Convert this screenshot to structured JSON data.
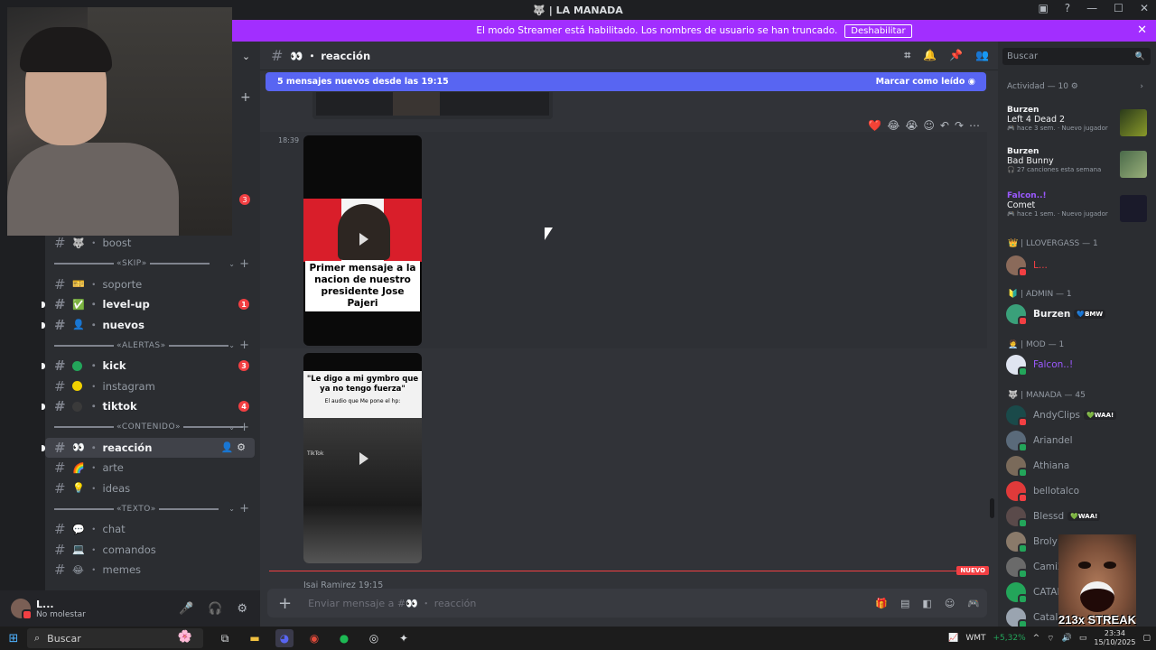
{
  "window": {
    "title": "🐺 | LA MANADA"
  },
  "streamer_bar": {
    "message": "El modo Streamer está habilitado. Los nombres de usuario se han truncado.",
    "button": "Deshabilitar",
    "close": "✕"
  },
  "sidebar": {
    "categories": {
      "skip": "«SKIP»",
      "alertas": "«ALERTAS»",
      "contenido": "«CONTENIDO»",
      "texto": "«TEXTO»"
    },
    "channels": {
      "boost": "boost",
      "soporte": "soporte",
      "level_up": "level-up",
      "nuevos": "nuevos",
      "kick": "kick",
      "instagram": "instagram",
      "tiktok": "tiktok",
      "reaccion": "reacción",
      "arte": "arte",
      "ideas": "ideas",
      "chat": "chat",
      "comandos": "comandos",
      "memes": "memes"
    },
    "badges": {
      "top": "3",
      "level_up": "1",
      "kick": "3",
      "tiktok": "4"
    }
  },
  "user": {
    "name": "L...",
    "status": "No molestar"
  },
  "channel": {
    "name": "reacción",
    "new_messages_banner": "5 mensajes nuevos desde las 19:15",
    "mark_read": "Marcar como leído",
    "timestamp": "18:39",
    "video1_caption": "Primer mensaje a la nacion de nuestro presidente Jose Pajeri",
    "video2_caption": "\"Le digo a mi gymbro que ya no tengo fuerza\"",
    "video2_sub": "El audio que Me pone el hp:",
    "video2_tag": "TikTok",
    "new_label": "NUEVO",
    "next_author": "Isai Ramirez  19:15",
    "composer_placeholder": "Enviar mensaje a #👀 ・ reacción"
  },
  "members": {
    "search_placeholder": "Buscar",
    "activity_header": "Actividad — 10",
    "activities": [
      {
        "user": "Burzen",
        "title": "Left 4 Dead 2",
        "meta": "🎮 hace 3 sem. · Nuevo jugador"
      },
      {
        "user": "Burzen",
        "title": "Bad Bunny",
        "meta": "🎧 27 canciones esta semana"
      },
      {
        "user": "Falcon..!",
        "title": "Comet",
        "meta": "🎮 hace 1 sem. · Nuevo jugador"
      }
    ],
    "groups": {
      "llovergass": "👑 | LLOVERGASS — 1",
      "admin": "🔰 | ADMIN — 1",
      "mod": "🧑‍💼 | MOD — 1",
      "manada": "🐺 | MANADA — 45"
    },
    "llovergass_member": "L...",
    "admin_member": "Burzen",
    "admin_tag": "💙BMW",
    "mod_member": "Falcon..!",
    "manada_members": [
      "AndyClips",
      "Ariandel",
      "Athiana",
      "bellotalco",
      "Blessd",
      "Broly",
      "Cami2",
      "CATAD",
      "Catalin"
    ],
    "tag_waa": "💚WAA!"
  },
  "overlay": {
    "streak": "213x STREAK"
  },
  "taskbar": {
    "search": "Buscar",
    "stock": "WMT",
    "stock_change": "+5,32%",
    "time": "23:34",
    "date": "15/10/2025"
  },
  "colors": {
    "accent": "#5865f2",
    "streamer": "#a22eff",
    "danger": "#f23f43",
    "online": "#23a55a"
  }
}
